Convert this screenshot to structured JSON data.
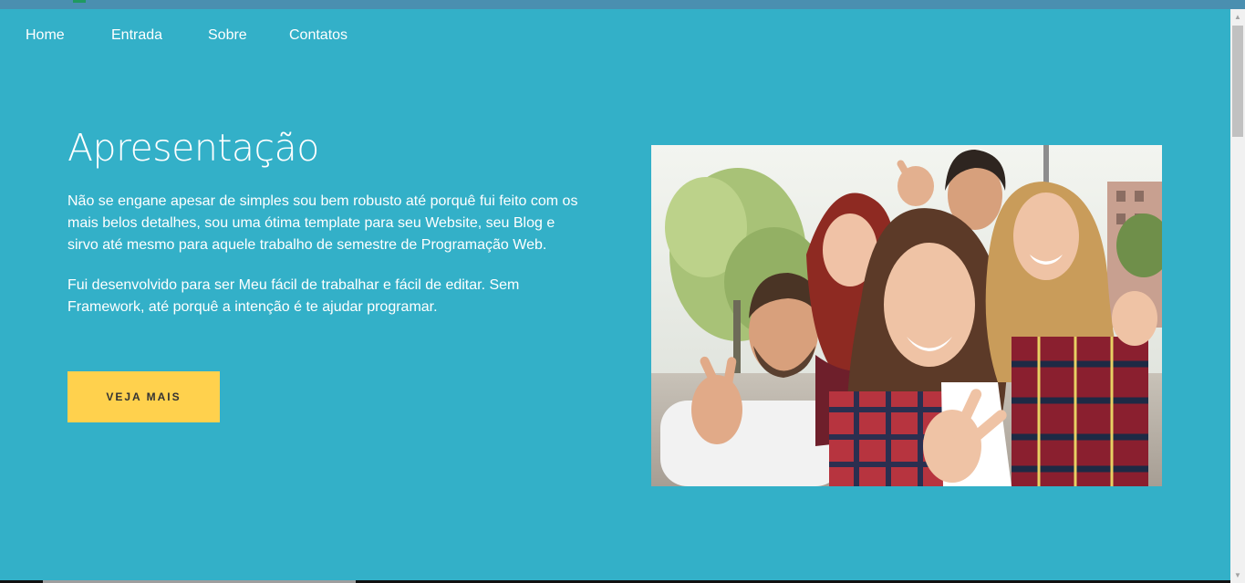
{
  "nav": {
    "items": [
      "Home",
      "Entrada",
      "Sobre",
      "Contatos"
    ]
  },
  "hero": {
    "title": "Apresentação",
    "paragraph1": "Não se engane apesar de simples sou bem robusto até porquê fui feito com os mais belos detalhes, sou uma ótima template para seu Website, seu Blog e sirvo até mesmo para aquele trabalho de semestre de Programação Web.",
    "paragraph2": "Fui desenvolvido para ser Meu fácil de trabalhar e fácil de editar. Sem Framework, até porquê a intenção é te ajudar programar.",
    "button_label": "VEJA MAIS"
  },
  "colors": {
    "background": "#33b0c8",
    "button": "#ffd14d",
    "text": "#ffffff"
  }
}
